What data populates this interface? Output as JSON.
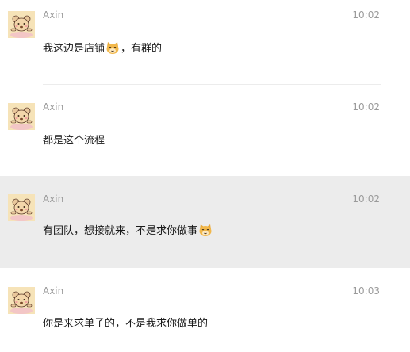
{
  "messages": [
    {
      "sender": "Axin",
      "time": "10:02",
      "text_before": "我这边是店铺",
      "emoji": "cat-face-emoji",
      "text_after": "，有群的",
      "highlighted": false
    },
    {
      "sender": "Axin",
      "time": "10:02",
      "text_before": "都是这个流程",
      "emoji": null,
      "text_after": "",
      "highlighted": false
    },
    {
      "sender": "Axin",
      "time": "10:02",
      "text_before": "有团队，想接就来，不是求你做事",
      "emoji": "cat-face-emoji",
      "text_after": "",
      "highlighted": true
    },
    {
      "sender": "Axin",
      "time": "10:03",
      "text_before": "你是来求单子的，不是我求你做单的",
      "emoji": null,
      "text_after": "",
      "highlighted": false
    }
  ],
  "colors": {
    "highlight_bg": "#ececec",
    "meta_text": "#9a9a9a",
    "body_text": "#1a1a1a",
    "avatar_bg": "#f6e3b8"
  }
}
